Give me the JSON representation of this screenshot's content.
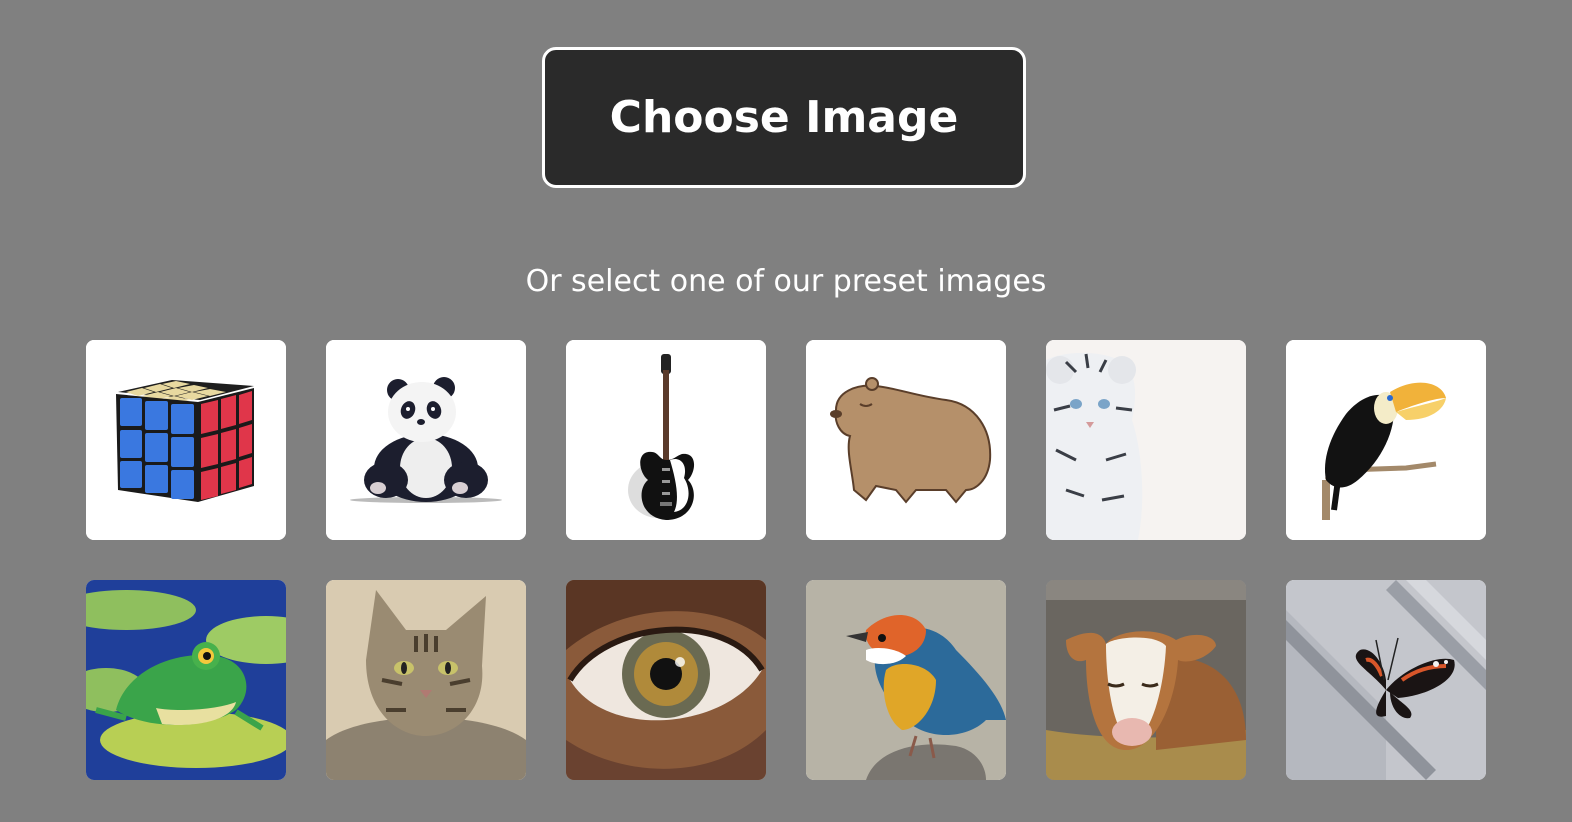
{
  "upload": {
    "button_label": "Choose Image"
  },
  "presets": {
    "subtitle": "Or select one of our preset images",
    "images": [
      {
        "name": "rubiks-cube"
      },
      {
        "name": "panda"
      },
      {
        "name": "electric-guitar"
      },
      {
        "name": "capybara"
      },
      {
        "name": "white-tiger-cub"
      },
      {
        "name": "toucan"
      },
      {
        "name": "frog"
      },
      {
        "name": "tabby-cat"
      },
      {
        "name": "eye"
      },
      {
        "name": "colorful-bird"
      },
      {
        "name": "calf"
      },
      {
        "name": "butterfly"
      }
    ]
  },
  "colors": {
    "background": "#808080",
    "button_bg": "#2a2a2a",
    "button_border": "#ffffff",
    "text": "#ffffff"
  }
}
